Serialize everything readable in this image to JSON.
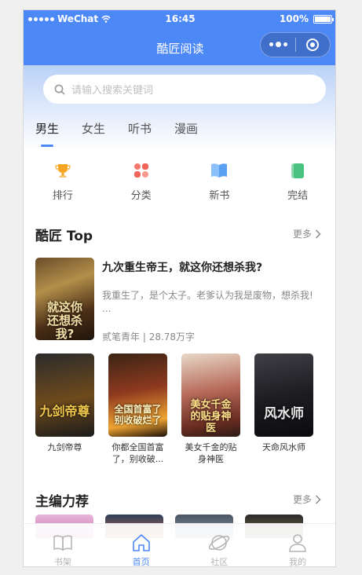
{
  "status_bar": {
    "carrier": "WeChat",
    "time": "16:45",
    "battery": "100%"
  },
  "nav": {
    "title": "酷匠阅读"
  },
  "search": {
    "placeholder": "请输入搜索关键词"
  },
  "tabs": [
    {
      "label": "男生",
      "active": true
    },
    {
      "label": "女生",
      "active": false
    },
    {
      "label": "听书",
      "active": false
    },
    {
      "label": "漫画",
      "active": false
    }
  ],
  "categories": [
    {
      "label": "排行",
      "icon": "trophy-icon",
      "color": "#f5a623"
    },
    {
      "label": "分类",
      "icon": "grid-icon",
      "color": "#f0645a"
    },
    {
      "label": "新书",
      "icon": "book-open-icon",
      "color": "#5aa0f2"
    },
    {
      "label": "完结",
      "icon": "bookmark-icon",
      "color": "#49c27f"
    }
  ],
  "top_section": {
    "title": "酷匠 Top",
    "more": "更多",
    "featured": {
      "title": "九次重生帝王，就这你还想杀我?",
      "description": "我重生了，是个太子。老爹认为我是废物，想杀我! ...",
      "author": "贰笔青年",
      "words": "28.78万字",
      "cover_text": "就这你还想杀我?"
    },
    "books": [
      {
        "name": "九剑帝尊",
        "cover_text": "九剑帝尊"
      },
      {
        "name": "你都全国首富了，别收破...",
        "cover_text": "全国首富了别收破烂了"
      },
      {
        "name": "美女千金的贴身神医",
        "cover_text": "美女千金的贴身神医"
      },
      {
        "name": "天命风水师",
        "cover_text": "风水师"
      }
    ]
  },
  "editor_section": {
    "title": "主编力荐",
    "more": "更多"
  },
  "tab_bar": [
    {
      "label": "书架",
      "icon": "bookshelf-icon",
      "active": false
    },
    {
      "label": "首页",
      "icon": "home-icon",
      "active": true
    },
    {
      "label": "社区",
      "icon": "planet-icon",
      "active": false
    },
    {
      "label": "我的",
      "icon": "user-icon",
      "active": false
    }
  ]
}
